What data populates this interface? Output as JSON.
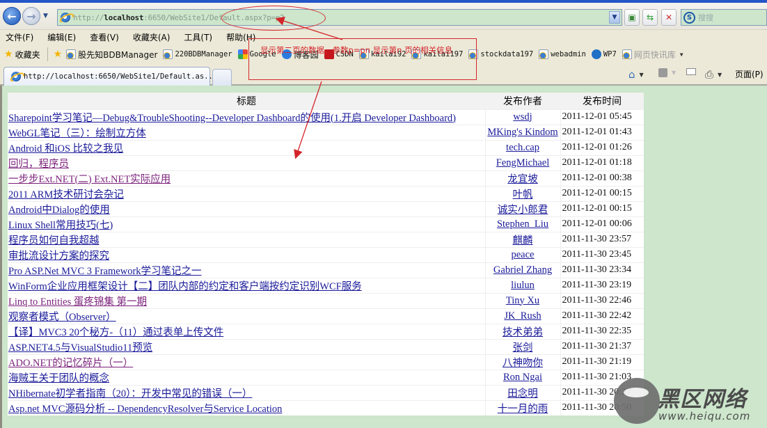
{
  "browser": {
    "address_url_prefix": "http://",
    "address_url_host": "localhost",
    "address_url_rest": ":6650/WebSite1/Default.aspx?p=p2",
    "search_placeholder": "搜搜",
    "menu": [
      "文件(F)",
      "编辑(E)",
      "查看(V)",
      "收藏夹(A)",
      "工具(T)",
      "帮助(H)"
    ],
    "favorites_label": "收藏夹",
    "favorites": [
      {
        "label": "股先知BDBManager",
        "icon": "ie-page-icon"
      },
      {
        "label": "220BDBManager",
        "icon": "ie-page-icon"
      },
      {
        "label": "Google",
        "icon": "google-icon"
      },
      {
        "label": "博客园",
        "icon": "cnblogs-icon"
      },
      {
        "label": "CSDN",
        "icon": "csdn-icon"
      },
      {
        "label": "kailai92",
        "icon": "ie-page-icon"
      },
      {
        "label": "kailai197",
        "icon": "ie-page-icon"
      },
      {
        "label": "stockdata197",
        "icon": "ie-page-icon"
      },
      {
        "label": "webadmin",
        "icon": "ie-page-icon"
      },
      {
        "label": "WP7",
        "icon": "wp7-icon"
      },
      {
        "label": "网页快讯库",
        "icon": "ie-page-icon"
      }
    ],
    "tab_title": "http://localhost:6650/WebSite1/Default.as...",
    "page_menu_label": "页面(P)"
  },
  "annotation": {
    "text": "显示第二页的数据，参数p=pn 显示第n 页的相关信息",
    "color": "#d4252b"
  },
  "table": {
    "headers": [
      "标题",
      "发布作者",
      "发布时间"
    ],
    "rows": [
      {
        "title": "Sharepoint学习笔记—Debug&TroubleShooting--Developer Dashboard的使用(1.开启 Developer Dashboard)",
        "author": "wsdj",
        "time": "2011-12-01 05:45",
        "visited": false
      },
      {
        "title": "WebGL笔记（三）：绘制立方体",
        "author": "MKing's Kindom",
        "time": "2011-12-01 01:43",
        "visited": false
      },
      {
        "title": "Android 和iOS 比较之我见",
        "author": "tech.cap",
        "time": "2011-12-01 01:26",
        "visited": false
      },
      {
        "title": "回归，程序员",
        "author": "FengMichael",
        "time": "2011-12-01 01:18",
        "visited": true
      },
      {
        "title": "一步步Ext.NET(二) Ext.NET实际应用",
        "author": "龙宜坡",
        "time": "2011-12-01 00:38",
        "visited": true
      },
      {
        "title": "2011 ARM技术研讨会杂记",
        "author": "叶帆",
        "time": "2011-12-01 00:15",
        "visited": false
      },
      {
        "title": "Android中Dialog的使用",
        "author": "诚实小郎君",
        "time": "2011-12-01 00:15",
        "visited": false
      },
      {
        "title": "Linux Shell常用技巧(七)",
        "author": "Stephen_Liu",
        "time": "2011-12-01 00:06",
        "visited": false
      },
      {
        "title": "程序员如何自我超越",
        "author": "麒麟",
        "time": "2011-11-30 23:57",
        "visited": false
      },
      {
        "title": "审批流设计方案的探究",
        "author": "peace",
        "time": "2011-11-30 23:45",
        "visited": false
      },
      {
        "title": "Pro ASP.Net MVC 3 Framework学习笔记之一",
        "author": "Gabriel Zhang",
        "time": "2011-11-30 23:34",
        "visited": false
      },
      {
        "title": "WinForm企业应用框架设计【二】团队内部的约定和客户端按约定识别WCF服务",
        "author": "liulun",
        "time": "2011-11-30 23:19",
        "visited": false
      },
      {
        "title": "Linq to Entities 蛋疼锦集 第一期",
        "author": "Tiny Xu",
        "time": "2011-11-30 22:46",
        "visited": true
      },
      {
        "title": "观察者模式（Observer）",
        "author": "JK_Rush",
        "time": "2011-11-30 22:42",
        "visited": false
      },
      {
        "title": "【译】MVC3 20个秘方-（11）通过表单上传文件",
        "author": "技术弟弟",
        "time": "2011-11-30 22:35",
        "visited": false
      },
      {
        "title": "ASP.NET4.5与VisualStudio11预览",
        "author": "张剑",
        "time": "2011-11-30 21:37",
        "visited": false
      },
      {
        "title": "ADO.NET的记忆碎片（一）",
        "author": "八神吻你",
        "time": "2011-11-30 21:19",
        "visited": true
      },
      {
        "title": "海贼王关于团队的概念",
        "author": "Ron Ngai",
        "time": "2011-11-30 21:03",
        "visited": false
      },
      {
        "title": "NHibernate初学者指南（20）：开发中常见的错误（一）",
        "author": "田念明",
        "time": "2011-11-30 20:27",
        "visited": false
      },
      {
        "title": "Asp.net MVC源码分析 -- DependencyResolver与Service Location",
        "author": "十一月的雨",
        "time": "2011-11-30 20:50",
        "visited": false
      }
    ]
  },
  "watermark": {
    "text": "黑区网络",
    "url": "www.heiqu.com"
  }
}
